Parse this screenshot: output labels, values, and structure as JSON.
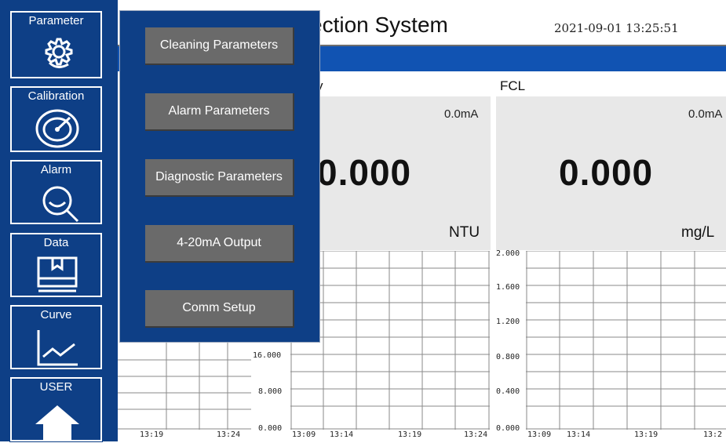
{
  "header": {
    "title_visible": "ection System",
    "datetime": "2021-09-01 13:25:51"
  },
  "sidebar": {
    "items": [
      {
        "label": "Parameter",
        "icon": "gear-icon"
      },
      {
        "label": "Calibration",
        "icon": "gauge-icon"
      },
      {
        "label": "Alarm",
        "icon": "magnifier-alarm-icon"
      },
      {
        "label": "Data",
        "icon": "data-box-icon"
      },
      {
        "label": "Curve",
        "icon": "line-chart-icon"
      },
      {
        "label": "USER",
        "icon": "home-icon"
      }
    ]
  },
  "dropdown": {
    "items": [
      "Cleaning Parameters",
      "Alarm Parameters",
      "Diagnostic Parameters",
      "4-20mA Output",
      "Comm Setup"
    ]
  },
  "sensors": [
    {
      "name_visible": "y",
      "current": "0.0mA",
      "value_visible": "0.000",
      "unit": "NTU",
      "chart": {
        "yticks": [
          "16.000",
          "8.000",
          "0.000"
        ],
        "xticks": [
          "13:09",
          "13:14",
          "13:19",
          "13:24"
        ]
      }
    },
    {
      "name": "FCL",
      "current": "0.0mA",
      "value": "0.000",
      "unit": "mg/L",
      "chart": {
        "yticks": [
          "2.000",
          "1.600",
          "1.200",
          "0.800",
          "0.400",
          "0.000"
        ],
        "xticks": [
          "13:09",
          "13:14",
          "13:19",
          "13:2"
        ]
      }
    }
  ],
  "left_partial_chart": {
    "xticks": [
      "13:19",
      "13:24"
    ]
  },
  "colors": {
    "navy": "#0e3f86",
    "header_blue": "#1153b2",
    "menu_button": "#6a6a6a",
    "panel": "#e8e8e8"
  }
}
